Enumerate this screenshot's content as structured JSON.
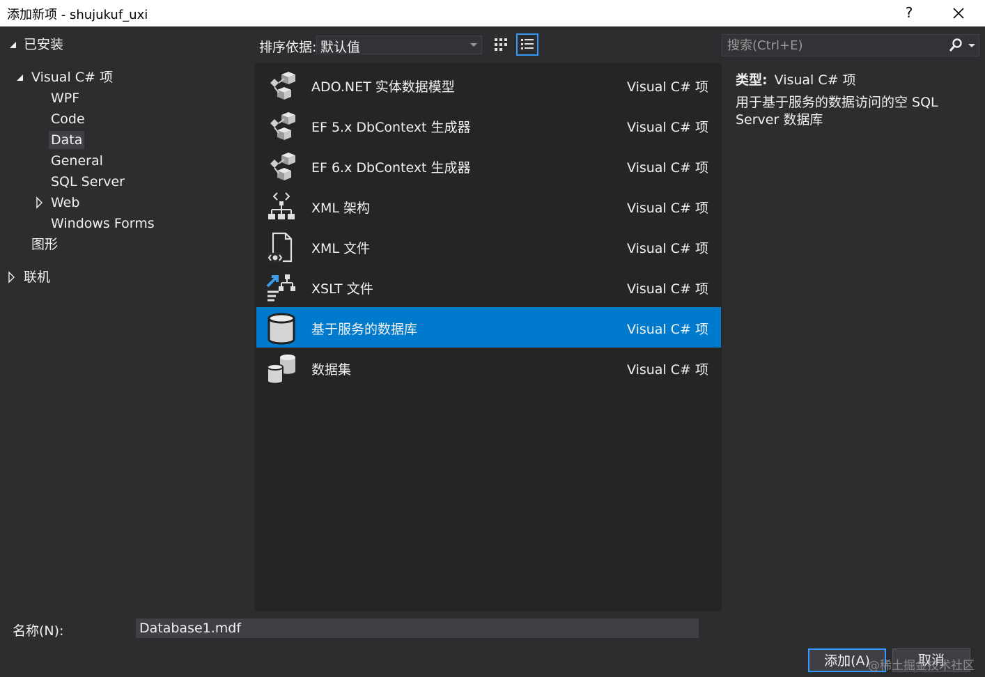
{
  "window": {
    "title": "添加新项 - shujukuf_uxi",
    "help_label": "?"
  },
  "tree": {
    "installed": "已安装",
    "visual_csharp": "Visual C# 项",
    "children": [
      "WPF",
      "Code",
      "Data",
      "General",
      "SQL Server",
      "Web",
      "Windows Forms"
    ],
    "graphics": "图形",
    "online": "联机"
  },
  "toolbar": {
    "sort_label": "排序依据:",
    "sort_value": "默认值"
  },
  "search": {
    "placeholder": "搜索(Ctrl+E)"
  },
  "items": [
    {
      "name": "ADO.NET 实体数据模型",
      "type": "Visual C# 项",
      "icon": "entity-model-icon"
    },
    {
      "name": "EF 5.x DbContext 生成器",
      "type": "Visual C# 项",
      "icon": "dbcontext-generator-icon"
    },
    {
      "name": "EF 6.x DbContext 生成器",
      "type": "Visual C# 项",
      "icon": "dbcontext-generator-icon"
    },
    {
      "name": "XML 架构",
      "type": "Visual C# 项",
      "icon": "xml-schema-icon"
    },
    {
      "name": "XML 文件",
      "type": "Visual C# 项",
      "icon": "xml-file-icon"
    },
    {
      "name": "XSLT 文件",
      "type": "Visual C# 项",
      "icon": "xslt-file-icon"
    },
    {
      "name": "基于服务的数据库",
      "type": "Visual C# 项",
      "icon": "database-icon"
    },
    {
      "name": "数据集",
      "type": "Visual C# 项",
      "icon": "dataset-icon"
    }
  ],
  "details": {
    "type_label": "类型:",
    "type_value": "Visual C# 项",
    "description": "用于基于服务的数据访问的空 SQL Server 数据库"
  },
  "bottom": {
    "name_label": "名称(N):",
    "name_value": "Database1.mdf",
    "add_button": "添加(A)",
    "cancel_button": "取消"
  },
  "watermark": "@稀土掘金技术社区",
  "colors": {
    "background": "#2d2d30",
    "list_bg": "#252526",
    "selection": "#007acc",
    "focus_border": "#3399ff"
  }
}
